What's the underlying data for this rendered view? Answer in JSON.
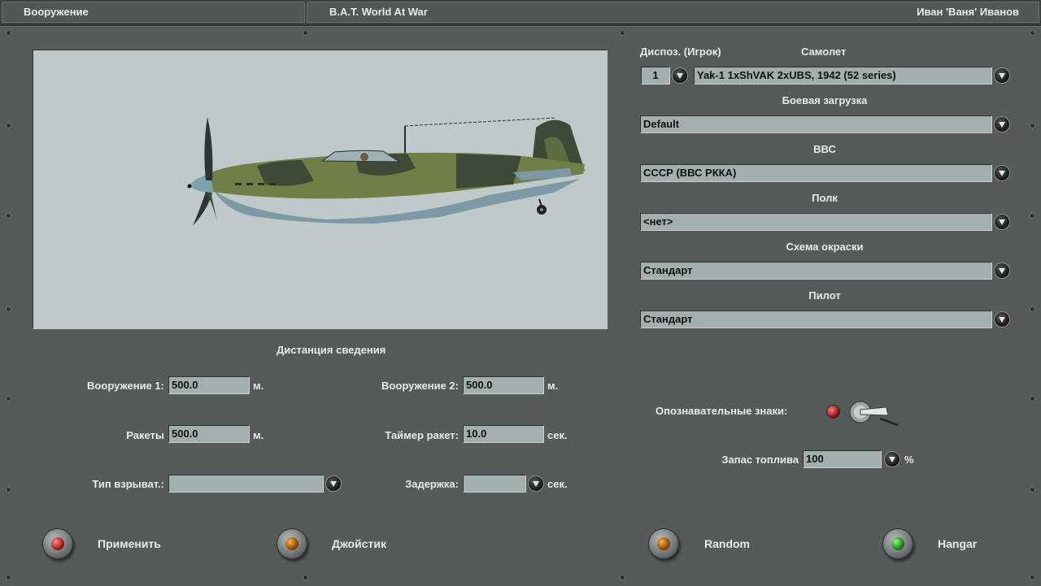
{
  "titlebar": {
    "section": "Вооружение",
    "game": "B.A.T. World At War",
    "player": "Иван 'Ваня' Иванов"
  },
  "aircraft_setup": {
    "slot_header": "Диспоз. (Игрок)",
    "plane_header": "Самолет",
    "slot_value": "1",
    "plane_value": "Yak-1 1xShVAK 2xUBS, 1942 (52 series)",
    "loadout_header": "Боевая загрузка",
    "loadout_value": "Default",
    "airforce_header": "ВВС",
    "airforce_value": "СССР (ВВС РККА)",
    "regiment_header": "Полк",
    "regiment_value": "<нет>",
    "skin_header": "Схема окраски",
    "skin_value": "Стандарт",
    "pilot_header": "Пилот",
    "pilot_value": "Стандарт"
  },
  "convergence": {
    "title": "Дистанция сведения",
    "weapon1_label": "Вооружение 1:",
    "weapon1_value": "500.0",
    "weapon2_label": "Вооружение 2:",
    "weapon2_value": "500.0",
    "rockets_label": "Ракеты",
    "rockets_value": "500.0",
    "rocket_timer_label": "Таймер ракет:",
    "rocket_timer_value": "10.0",
    "fuze_label": "Тип взрыват.:",
    "fuze_value": "",
    "delay_label": "Задержка:",
    "delay_value": "",
    "unit_m": "м.",
    "unit_sec": "сек."
  },
  "markings": {
    "label": "Опознавательные знаки:",
    "fuel_label": "Запас топлива",
    "fuel_value": "100",
    "fuel_unit": "%"
  },
  "buttons": {
    "apply": "Применить",
    "joystick": "Джойстик",
    "random": "Random",
    "hangar": "Hangar"
  },
  "colors": {
    "panel": "#555a5b",
    "field": "#a3aeae",
    "viewer_bg": "#bfc9c9"
  },
  "icons": [
    "chevron-down-icon",
    "red-lamp-icon",
    "orange-lamp-icon",
    "green-lamp-icon",
    "toggle-switch-icon",
    "mouse-cursor-icon"
  ]
}
